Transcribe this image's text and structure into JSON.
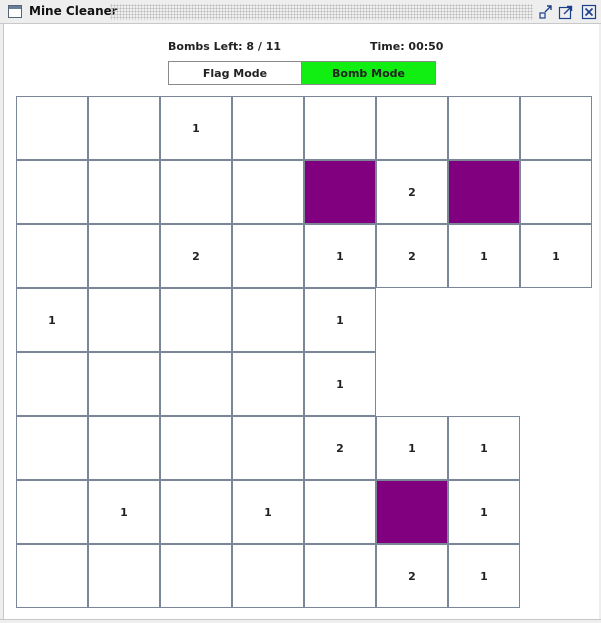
{
  "window": {
    "title": "Mine Cleaner"
  },
  "status": {
    "bombs_left": "Bombs Left: 8 / 11",
    "time": "Time: 00:50"
  },
  "modes": {
    "flag_label": "Flag Mode",
    "bomb_label": "Bomb Mode",
    "active": "bomb"
  },
  "colors": {
    "active_mode": "#11ee11",
    "bomb_cell": "#800080",
    "cell_border": "#7a8797"
  },
  "grid": {
    "rows": [
      [
        {
          "t": ""
        },
        {
          "t": ""
        },
        {
          "t": "1"
        },
        {
          "t": ""
        },
        {
          "t": ""
        },
        {
          "t": ""
        },
        {
          "t": ""
        },
        {
          "t": ""
        }
      ],
      [
        {
          "t": ""
        },
        {
          "t": ""
        },
        {
          "t": ""
        },
        {
          "t": ""
        },
        {
          "t": "",
          "bomb": true
        },
        {
          "t": "2"
        },
        {
          "t": "",
          "bomb": true
        },
        {
          "t": ""
        }
      ],
      [
        {
          "t": ""
        },
        {
          "t": ""
        },
        {
          "t": "2"
        },
        {
          "t": ""
        },
        {
          "t": "1"
        },
        {
          "t": "2"
        },
        {
          "t": "1"
        },
        {
          "t": "1"
        }
      ],
      [
        {
          "t": "1"
        },
        {
          "t": ""
        },
        {
          "t": ""
        },
        {
          "t": ""
        },
        {
          "t": "1"
        },
        null,
        null,
        null
      ],
      [
        {
          "t": ""
        },
        {
          "t": ""
        },
        {
          "t": ""
        },
        {
          "t": ""
        },
        {
          "t": "1"
        },
        null,
        null,
        null
      ],
      [
        {
          "t": ""
        },
        {
          "t": ""
        },
        {
          "t": ""
        },
        {
          "t": ""
        },
        {
          "t": "2"
        },
        {
          "t": "1"
        },
        {
          "t": "1"
        },
        null
      ],
      [
        {
          "t": ""
        },
        {
          "t": "1"
        },
        {
          "t": ""
        },
        {
          "t": "1"
        },
        {
          "t": ""
        },
        {
          "t": "",
          "bomb": true
        },
        {
          "t": "1"
        },
        null
      ],
      [
        {
          "t": ""
        },
        {
          "t": ""
        },
        {
          "t": ""
        },
        {
          "t": ""
        },
        {
          "t": ""
        },
        {
          "t": "2"
        },
        {
          "t": "1"
        },
        null
      ]
    ]
  }
}
